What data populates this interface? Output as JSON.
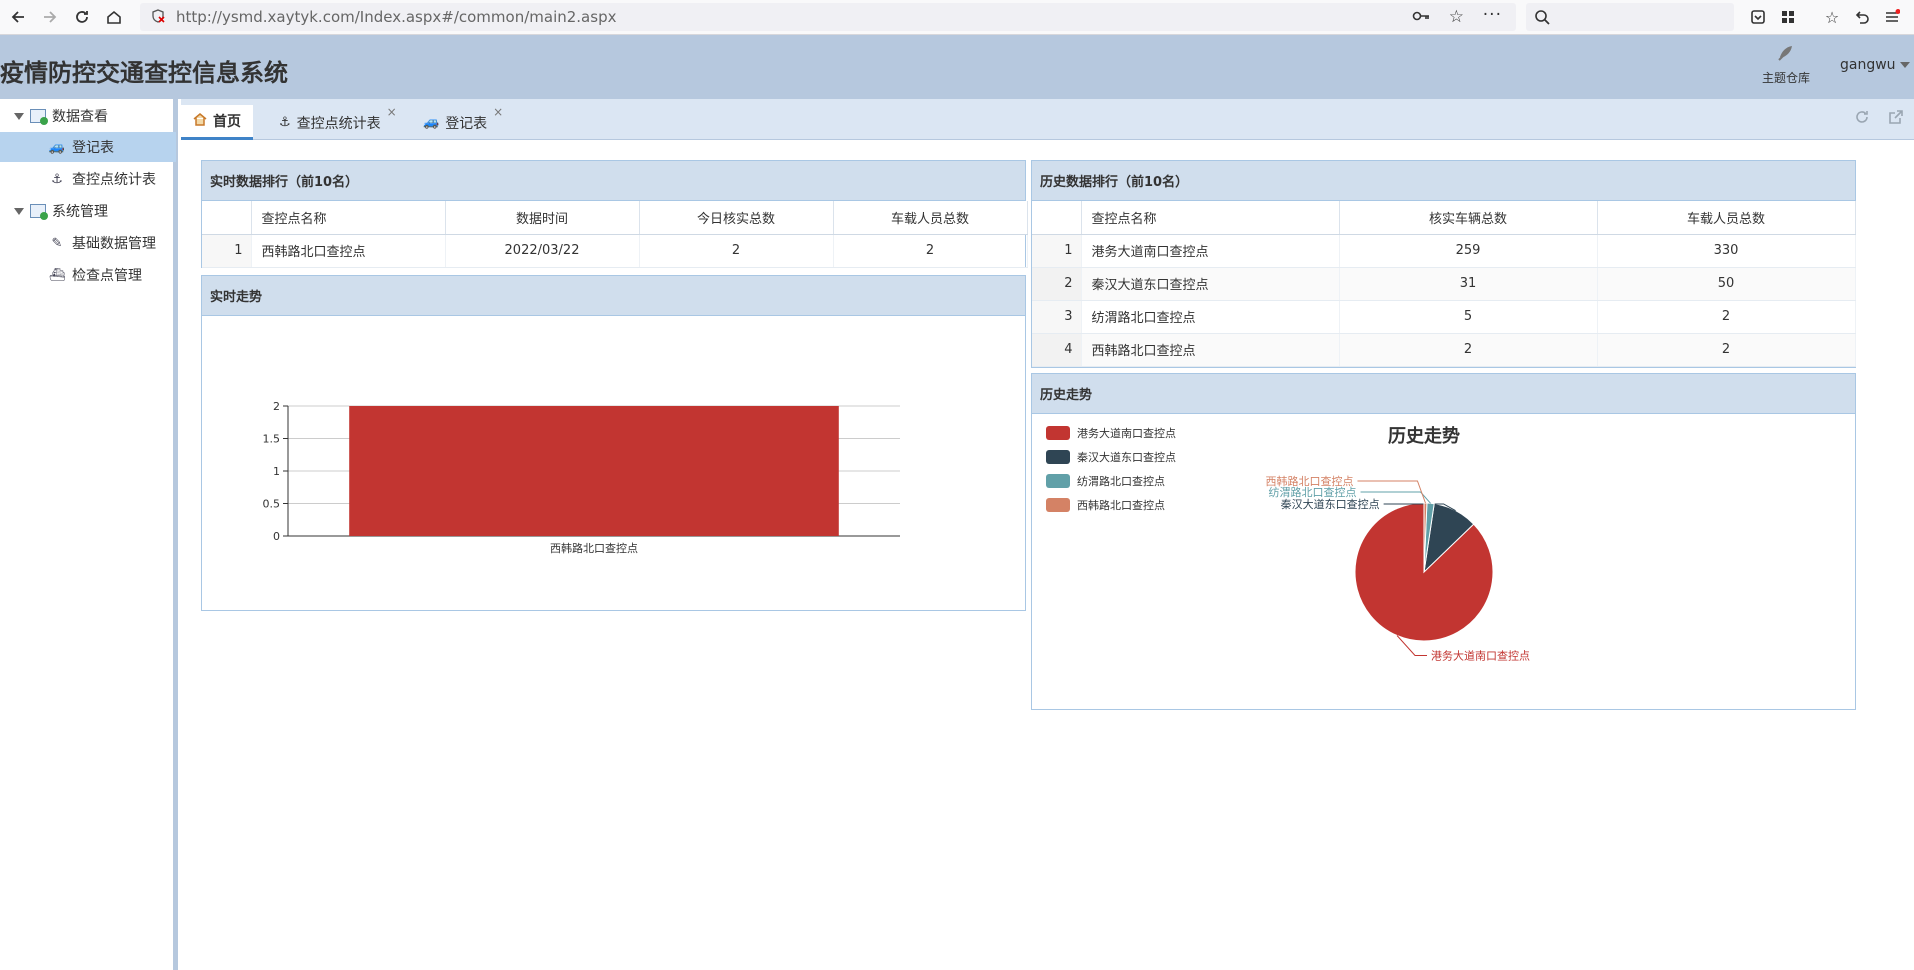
{
  "browser": {
    "url": "http://ysmd.xaytyk.com/Index.aspx#/common/main2.aspx"
  },
  "header": {
    "title": "疫情防控交通查控信息系统",
    "theme_label": "主题仓库",
    "user": "gangwu"
  },
  "sidebar": {
    "groups": [
      {
        "label": "数据查看",
        "items": [
          "登记表",
          "查控点统计表"
        ]
      },
      {
        "label": "系统管理",
        "items": [
          "基础数据管理",
          "检查点管理"
        ]
      }
    ]
  },
  "tabs": [
    {
      "label": "首页",
      "icon": "home-icon"
    },
    {
      "label": "查控点统计表",
      "icon": "anchor-icon"
    },
    {
      "label": "登记表",
      "icon": "car-icon"
    }
  ],
  "realtime_rank": {
    "title": "实时数据排行（前10名）",
    "columns": [
      "查控点名称",
      "数据时间",
      "今日核实总数",
      "车载人员总数"
    ],
    "rows": [
      {
        "index": "1",
        "name": "西韩路北口查控点",
        "time": "2022/03/22",
        "verified": "2",
        "people": "2"
      }
    ]
  },
  "realtime_trend": {
    "title": "实时走势"
  },
  "history_rank": {
    "title": "历史数据排行（前10名）",
    "columns": [
      "查控点名称",
      "核实车辆总数",
      "车载人员总数"
    ],
    "rows": [
      {
        "index": "1",
        "name": "港务大道南口查控点",
        "vehicles": "259",
        "people": "330"
      },
      {
        "index": "2",
        "name": "秦汉大道东口查控点",
        "vehicles": "31",
        "people": "50"
      },
      {
        "index": "3",
        "name": "纺渭路北口查控点",
        "vehicles": "5",
        "people": "2"
      },
      {
        "index": "4",
        "name": "西韩路北口查控点",
        "vehicles": "2",
        "people": "2"
      }
    ]
  },
  "history_trend": {
    "title": "历史走势"
  },
  "chart_data": [
    {
      "type": "bar",
      "categories": [
        "西韩路北口查控点"
      ],
      "values": [
        2
      ],
      "ylim": [
        0,
        2
      ],
      "yticks": [
        "0",
        "0.5",
        "1",
        "1.5",
        "2"
      ],
      "color": "#c23531"
    },
    {
      "type": "pie",
      "title": "历史走势",
      "legend_position": "top-left",
      "labels": [
        "港务大道南口查控点",
        "秦汉大道东口查控点",
        "纺渭路北口查控点",
        "西韩路北口查控点"
      ],
      "values": [
        259,
        31,
        5,
        2
      ],
      "colors": [
        "#c23531",
        "#2f4554",
        "#61a0a8",
        "#d48265"
      ]
    }
  ]
}
